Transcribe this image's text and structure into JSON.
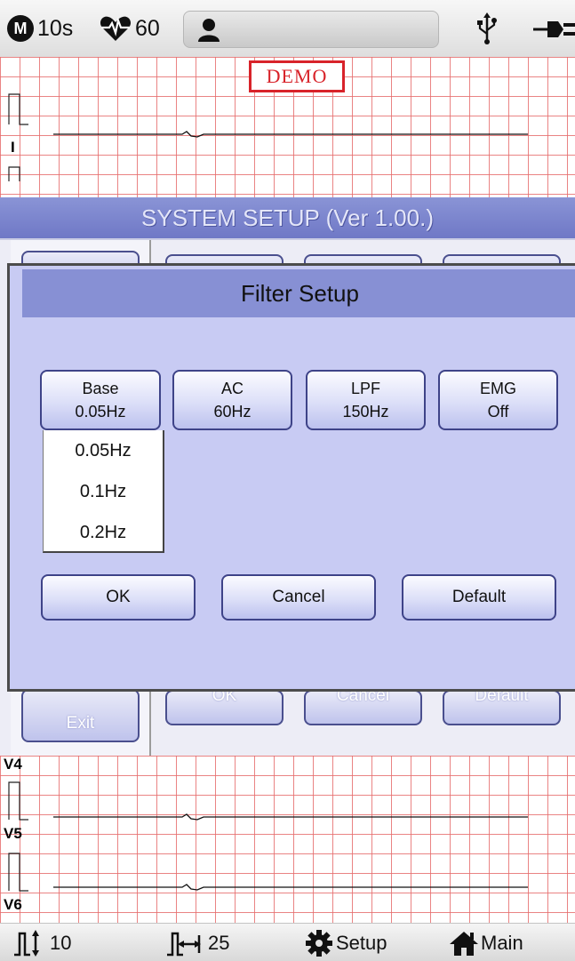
{
  "status": {
    "mode_letter": "M",
    "record_time": "10s",
    "heart_rate": "60"
  },
  "ecg": {
    "demo_label": "DEMO",
    "leads_top": [
      "I"
    ],
    "leads_bottom": [
      "V4",
      "V5",
      "V6"
    ]
  },
  "system_setup": {
    "title": "SYSTEM SETUP (Ver 1.00.)",
    "exit_label": "Exit",
    "ok_label": "OK",
    "cancel_label": "Cancel",
    "default_label": "Default"
  },
  "filter_dialog": {
    "title": "Filter Setup",
    "filters": [
      {
        "name": "Base",
        "value": "0.05Hz"
      },
      {
        "name": "AC",
        "value": "60Hz"
      },
      {
        "name": "LPF",
        "value": "150Hz"
      },
      {
        "name": "EMG",
        "value": "Off"
      }
    ],
    "base_options": [
      "0.05Hz",
      "0.1Hz",
      "0.2Hz"
    ],
    "ok_label": "OK",
    "cancel_label": "Cancel",
    "default_label": "Default"
  },
  "toolbar": {
    "gain": "10",
    "speed": "25",
    "setup_label": "Setup",
    "main_label": "Main"
  }
}
